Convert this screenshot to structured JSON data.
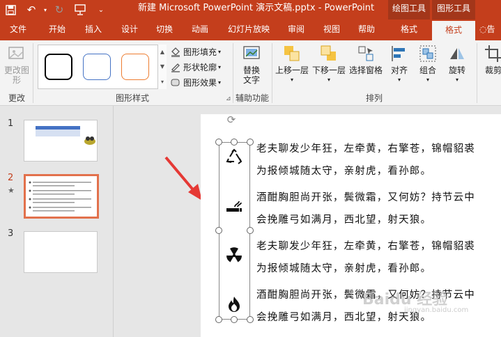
{
  "titlebar": {
    "title": "新建 Microsoft PowerPoint 演示文稿.pptx  -  PowerPoint",
    "context_tab_drawing": "绘图工具",
    "context_tab_picture": "图形工具"
  },
  "tabs": [
    "文件",
    "开始",
    "插入",
    "设计",
    "切换",
    "动画",
    "幻灯片放映",
    "审阅",
    "视图",
    "帮助",
    "格式",
    "格式",
    "告"
  ],
  "ribbon": {
    "change_picture_line1": "更改图",
    "change_picture_line2": "形",
    "group_change": "更改",
    "group_shape_styles": "图形样式",
    "shape_fill": "图形填充",
    "shape_outline": "形状轮廓",
    "shape_effects": "图形效果",
    "alt_text_line1": "替换",
    "alt_text_line2": "文字",
    "group_accessibility": "辅助功能",
    "bring_forward": "上移一层",
    "send_backward": "下移一层",
    "selection_pane": "选择窗格",
    "align": "对齐",
    "group": "组合",
    "rotate": "旋转",
    "crop": "裁剪",
    "group_arrange": "排列"
  },
  "slides": {
    "numbers": [
      "1",
      "2",
      "3"
    ],
    "star": "★"
  },
  "slide_text": {
    "line1": "老夫聊发少年狂，左牵黄，右擎苍，锦帽貂裘",
    "line2": "为报倾城随太守，亲射虎，看孙郎。",
    "line3": "酒酣胸胆尚开张，鬓微霜，又何妨？持节云中",
    "line4": "会挽雕弓如满月，西北望，射天狼。",
    "line5": "老夫聊发少年狂，左牵黄，右擎苍，锦帽貂裘",
    "line6": "为报倾城随太守，亲射虎，看孙郎。",
    "line7": "酒酣胸胆尚开张，鬓微霜，又何妨？持节云中",
    "line8": "会挽雕弓如满月，西北望，射天狼。"
  },
  "watermark": {
    "main": "Baidu 经验",
    "sub": "jingyan.baidu.com"
  },
  "colors": {
    "accent": "#c43e1c",
    "accent_dark": "#a3361a",
    "arrow": "#e53935",
    "swatch_black": "#000000",
    "swatch_blue": "#4472c4",
    "swatch_orange": "#ed7d31"
  }
}
